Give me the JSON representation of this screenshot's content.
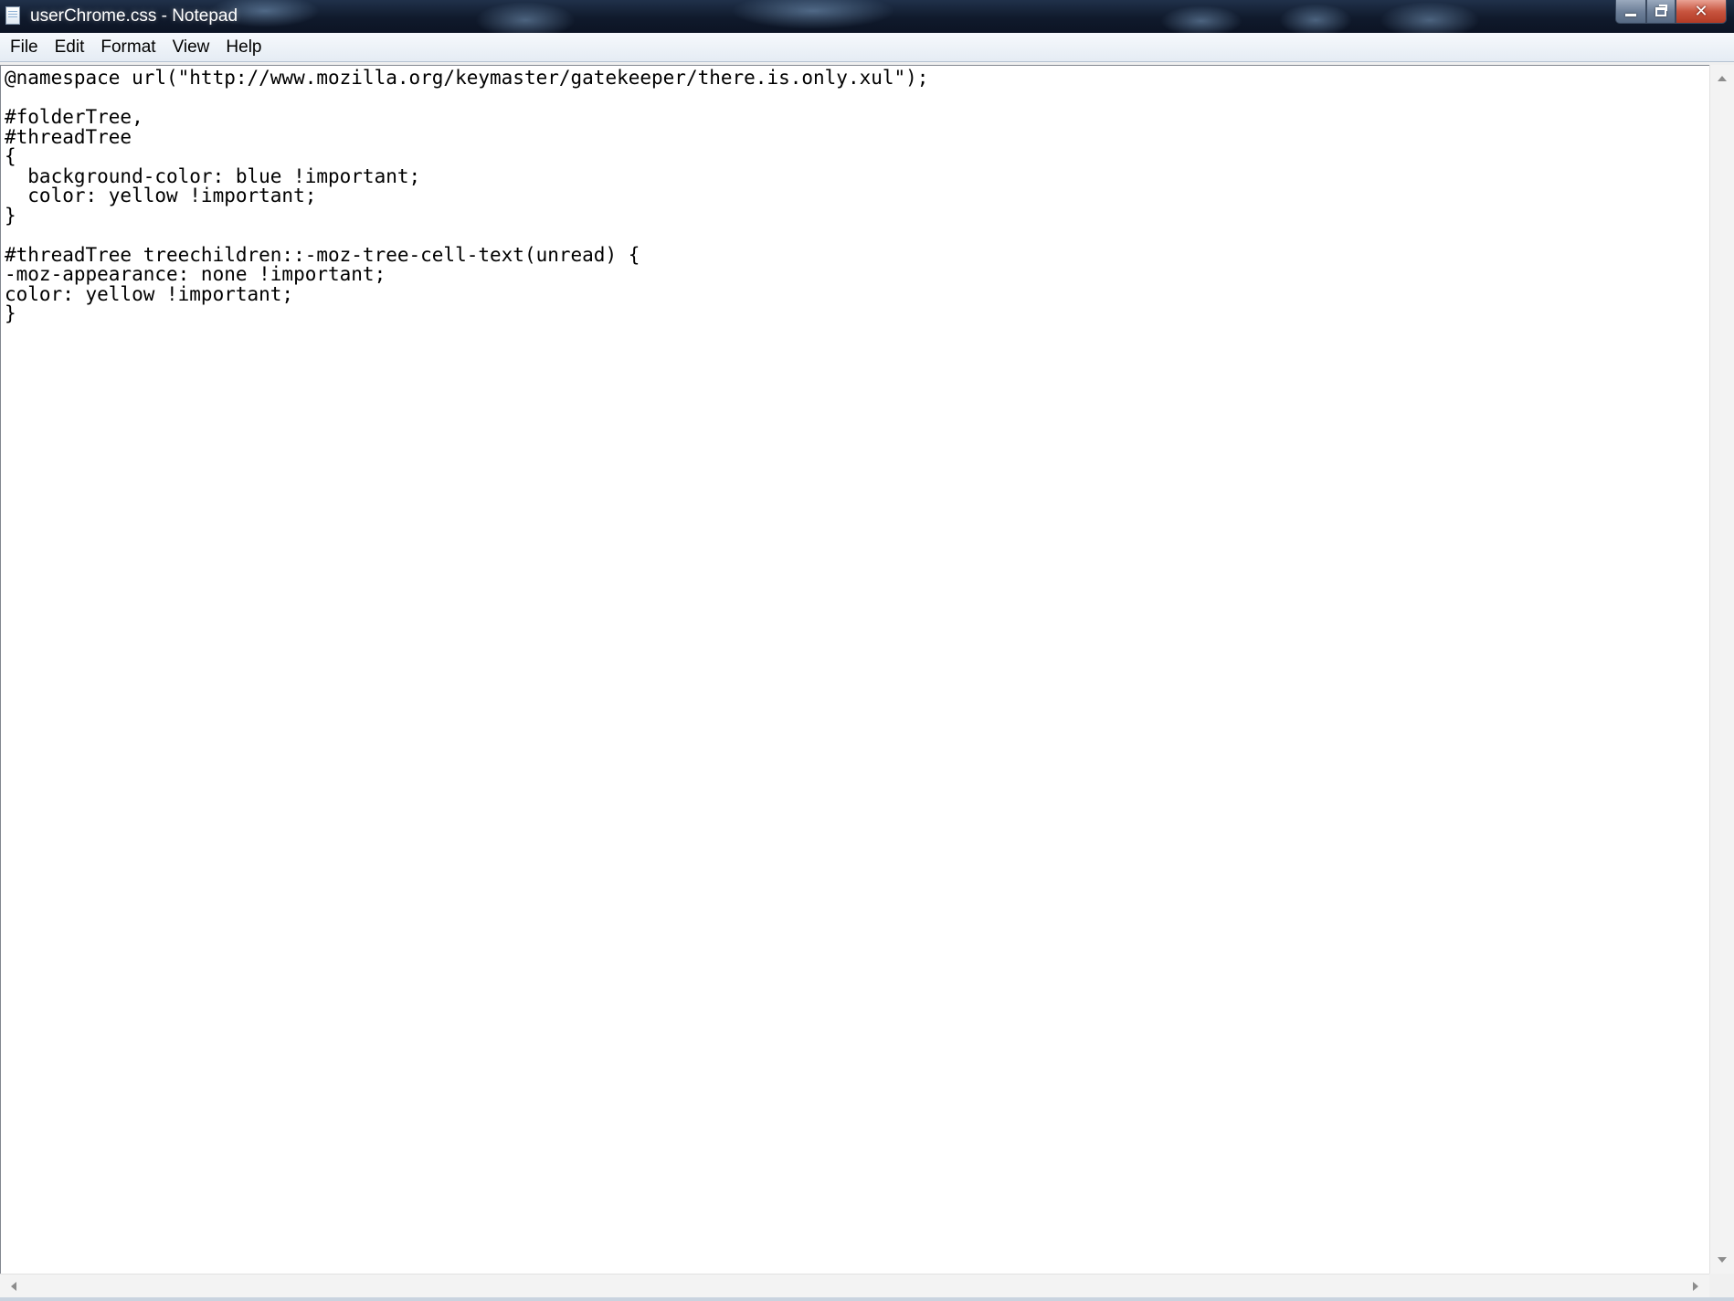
{
  "window": {
    "title": "userChrome.css - Notepad"
  },
  "menu": {
    "items": [
      {
        "label": "File"
      },
      {
        "label": "Edit"
      },
      {
        "label": "Format"
      },
      {
        "label": "View"
      },
      {
        "label": "Help"
      }
    ]
  },
  "editor": {
    "lines": [
      "@namespace url(\"http://www.mozilla.org/keymaster/gatekeeper/there.is.only.xul\");",
      "",
      "#folderTree,",
      "#threadTree",
      "{",
      "  background-color: blue !important;",
      "  color: yellow !important;",
      "}",
      "",
      "#threadTree treechildren::-moz-tree-cell-text(unread) {",
      "-moz-appearance: none !important;",
      "color: yellow !important;",
      "}"
    ]
  },
  "icons": {
    "app": "notepad-icon",
    "minimize": "minimize-icon",
    "maximize": "restore-icon",
    "close": "close-icon"
  },
  "colors": {
    "titlebar": "#101a2c",
    "close_button": "#c8553f",
    "menubar": "#eef3f8",
    "editor_background": "#ffffff",
    "text": "#000000"
  }
}
